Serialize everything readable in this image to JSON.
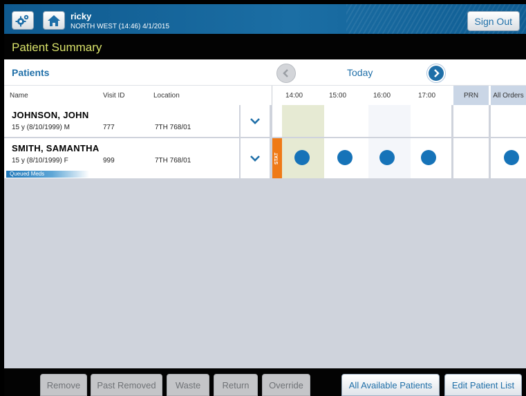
{
  "header": {
    "user": "ricky",
    "location": "NORTH WEST (14:46) 4/1/2015",
    "sign_out": "Sign Out"
  },
  "page_title": "Patient Summary",
  "patients_label": "Patients",
  "date_nav": {
    "label": "Today"
  },
  "columns": {
    "name": "Name",
    "visit_id": "Visit ID",
    "location": "Location",
    "times": [
      "14:00",
      "15:00",
      "16:00",
      "17:00"
    ],
    "prn": "PRN",
    "all_orders": "All Orders"
  },
  "patients": [
    {
      "name": "JOHNSON, JOHN",
      "demo": "15 y (8/10/1999) M",
      "visit_id": "777",
      "location": "7TH 768/01"
    },
    {
      "name": "SMITH, SAMANTHA",
      "demo": "15 y (8/10/1999) F",
      "visit_id": "999",
      "location": "7TH 768/01",
      "queued": "Queued Meds",
      "stat": "STAT"
    }
  ],
  "toolbar": {
    "remove": "Remove",
    "past_removed": "Past Removed",
    "waste": "Waste",
    "return": "Return",
    "override": "Override",
    "all_available": "All Available Patients",
    "edit_list": "Edit Patient List"
  },
  "colors": {
    "header_blue": "#1b6ea4",
    "title_yellow": "#d9e26a",
    "dose_dot": "#1673b8",
    "stat_orange": "#ef7a17",
    "current_hour_highlight": "#e6ead3"
  }
}
